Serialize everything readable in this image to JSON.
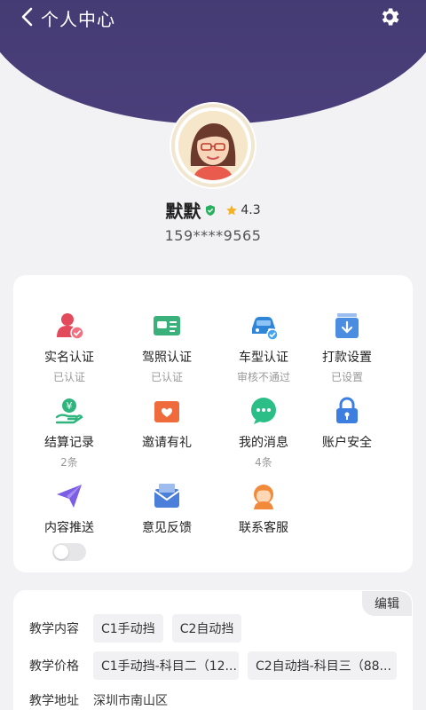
{
  "header": {
    "back_label": "个人中心",
    "title": "个人中心"
  },
  "profile": {
    "name": "默默",
    "rating": "4.3",
    "phone": "159****9565"
  },
  "grid": [
    {
      "label": "实名认证",
      "status": "已认证",
      "icon": "id-person-check-icon",
      "color": "#e34a5b"
    },
    {
      "label": "驾照认证",
      "status": "已认证",
      "icon": "license-card-icon",
      "color": "#3ab07a"
    },
    {
      "label": "车型认证",
      "status": "审核不通过",
      "icon": "car-check-icon",
      "color": "#2f86d8"
    },
    {
      "label": "打款设置",
      "status": "已设置",
      "icon": "download-tray-icon",
      "color": "#4b8de0"
    },
    {
      "label": "结算记录",
      "status": "2条",
      "icon": "yen-hand-icon",
      "color": "#2eb57e"
    },
    {
      "label": "邀请有礼",
      "status": "",
      "icon": "gift-envelope-icon",
      "color": "#ef6b3b"
    },
    {
      "label": "我的消息",
      "status": "4条",
      "icon": "chat-bubble-icon",
      "color": "#2bbf87"
    },
    {
      "label": "账户安全",
      "status": "",
      "icon": "lock-icon",
      "color": "#3d7fe0"
    },
    {
      "label": "内容推送",
      "status": "",
      "icon": "send-plane-icon",
      "color": "#7b5de6"
    },
    {
      "label": "意见反馈",
      "status": "",
      "icon": "mail-feedback-icon",
      "color": "#4c7fd9"
    },
    {
      "label": "联系客服",
      "status": "",
      "icon": "customer-service-icon",
      "color": "#f28a3c"
    }
  ],
  "teaching": {
    "edit_label": "编辑",
    "content_label": "教学内容",
    "content_tags": [
      "C1手动挡",
      "C2自动挡"
    ],
    "price_label": "教学价格",
    "price_tags": [
      "C1手动挡-科目二（12...",
      "C2自动挡-科目三（88..."
    ],
    "address_label": "教学地址",
    "address": "深圳市南山区"
  }
}
